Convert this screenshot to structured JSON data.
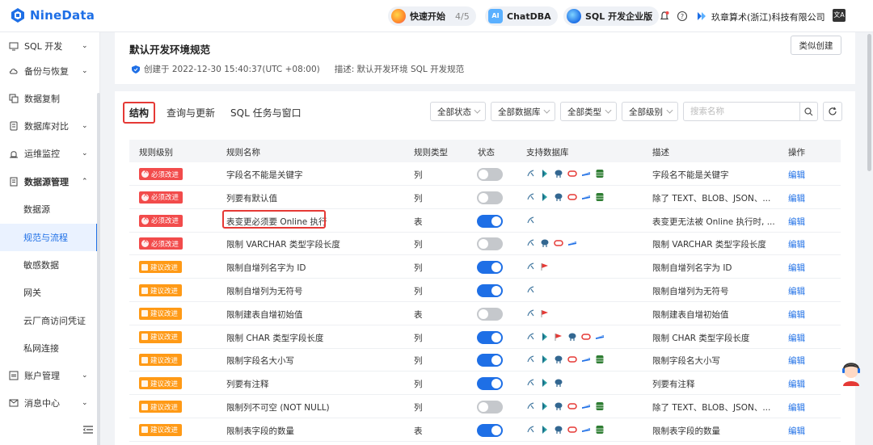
{
  "topbar": {
    "logo": "NineData",
    "quickstart": {
      "label": "快速开始",
      "progress": "4/5"
    },
    "chatdba": "ChatDBA",
    "edition": "SQL 开发企业版",
    "company": "玖章算术(浙江)科技有限公司",
    "lang": "文A"
  },
  "sidebar": {
    "items": [
      {
        "label": "SQL 开发",
        "chevron": "⌄"
      },
      {
        "label": "备份与恢复",
        "chevron": "⌄"
      },
      {
        "label": "数据复制"
      },
      {
        "label": "数据库对比",
        "chevron": "⌄"
      },
      {
        "label": "运维监控",
        "chevron": "⌄"
      },
      {
        "label": "数据源管理",
        "chevron": "⌃"
      },
      {
        "label": "数据源"
      },
      {
        "label": "规范与流程"
      },
      {
        "label": "敏感数据"
      },
      {
        "label": "网关"
      },
      {
        "label": "云厂商访问凭证"
      },
      {
        "label": "私网连接"
      },
      {
        "label": "账户管理",
        "chevron": "⌄"
      },
      {
        "label": "消息中心",
        "chevron": "⌄"
      }
    ]
  },
  "header": {
    "title": "默认开发环境规范",
    "created": "创建于 2022-12-30 15:40:37(UTC +08:00)",
    "desc": "描述:  默认开发环境 SQL 开发规范",
    "similar_button": "类似创建"
  },
  "tabs": [
    "结构",
    "查询与更新",
    "SQL 任务与窗口"
  ],
  "filters": {
    "status": "全部状态",
    "database": "全部数据库",
    "type": "全部类型",
    "level": "全部级别",
    "search_placeholder": "搜索名称"
  },
  "table": {
    "headers": [
      "规则级别",
      "规则名称",
      "规则类型",
      "状态",
      "支持数据库",
      "描述",
      "操作"
    ],
    "rows": [
      {
        "level": "必须改进",
        "level_color": "red",
        "name": "字段名不能是关键字",
        "type": "列",
        "on": false,
        "dbs": [
          "mysql",
          "hive",
          "pg",
          "oracle",
          "sqlserver",
          "mongo"
        ],
        "desc": "字段名不能是关键字",
        "action": "编辑"
      },
      {
        "level": "必须改进",
        "level_color": "red",
        "name": "列要有默认值",
        "type": "列",
        "on": false,
        "dbs": [
          "mysql",
          "hive",
          "pg",
          "oracle",
          "sqlserver",
          "mongo"
        ],
        "desc": "除了 TEXT、BLOB、JSON、...",
        "action": "编辑"
      },
      {
        "level": "必须改进",
        "level_color": "red",
        "name": "表变更必须要 Online 执行",
        "type": "表",
        "on": true,
        "dbs": [
          "mysql"
        ],
        "desc": "表变更无法被 Online 执行时, ...",
        "action": "编辑"
      },
      {
        "level": "必须改进",
        "level_color": "red",
        "name": "限制 VARCHAR 类型字段长度",
        "type": "列",
        "on": false,
        "dbs": [
          "mysql",
          "pg",
          "oracle",
          "sqlserver"
        ],
        "desc": "限制 VARCHAR 类型字段长度",
        "action": "编辑"
      },
      {
        "level": "建议改进",
        "level_color": "orange",
        "name": "限制自增列名字为 ID",
        "type": "列",
        "on": true,
        "dbs": [
          "mysql",
          "flag"
        ],
        "desc": "限制自增列名字为 ID",
        "action": "编辑"
      },
      {
        "level": "建议改进",
        "level_color": "orange",
        "name": "限制自增列为无符号",
        "type": "列",
        "on": true,
        "dbs": [
          "mysql"
        ],
        "desc": "限制自增列为无符号",
        "action": "编辑"
      },
      {
        "level": "建议改进",
        "level_color": "orange",
        "name": "限制建表自增初始值",
        "type": "表",
        "on": false,
        "dbs": [
          "mysql",
          "flag"
        ],
        "desc": "限制建表自增初始值",
        "action": "编辑"
      },
      {
        "level": "建议改进",
        "level_color": "orange",
        "name": "限制 CHAR 类型字段长度",
        "type": "列",
        "on": true,
        "dbs": [
          "mysql",
          "hive",
          "flag",
          "pg",
          "oracle",
          "sqlserver"
        ],
        "desc": "限制 CHAR 类型字段长度",
        "action": "编辑"
      },
      {
        "level": "建议改进",
        "level_color": "orange",
        "name": "限制字段名大小写",
        "type": "列",
        "on": true,
        "dbs": [
          "mysql",
          "hive",
          "pg",
          "oracle",
          "sqlserver",
          "mongo"
        ],
        "desc": "限制字段名大小写",
        "action": "编辑"
      },
      {
        "level": "建议改进",
        "level_color": "orange",
        "name": "列要有注释",
        "type": "列",
        "on": true,
        "dbs": [
          "mysql",
          "hive",
          "pg"
        ],
        "desc": "列要有注释",
        "action": "编辑"
      },
      {
        "level": "建议改进",
        "level_color": "orange",
        "name": "限制列不可空 (NOT NULL)",
        "type": "列",
        "on": false,
        "dbs": [
          "mysql",
          "hive",
          "pg",
          "oracle",
          "sqlserver",
          "mongo"
        ],
        "desc": "除了 TEXT、BLOB、JSON、...",
        "action": "编辑"
      },
      {
        "level": "建议改进",
        "level_color": "orange",
        "name": "限制表字段的数量",
        "type": "表",
        "on": true,
        "dbs": [
          "mysql",
          "hive",
          "pg",
          "oracle",
          "sqlserver",
          "mongo"
        ],
        "desc": "限制表字段的数量",
        "action": "编辑"
      }
    ]
  },
  "colors": {
    "accent": "#1e6fe6",
    "red_badge": "#f24b4b",
    "orange_badge": "#ff9a16",
    "highlight": "#e53935"
  }
}
